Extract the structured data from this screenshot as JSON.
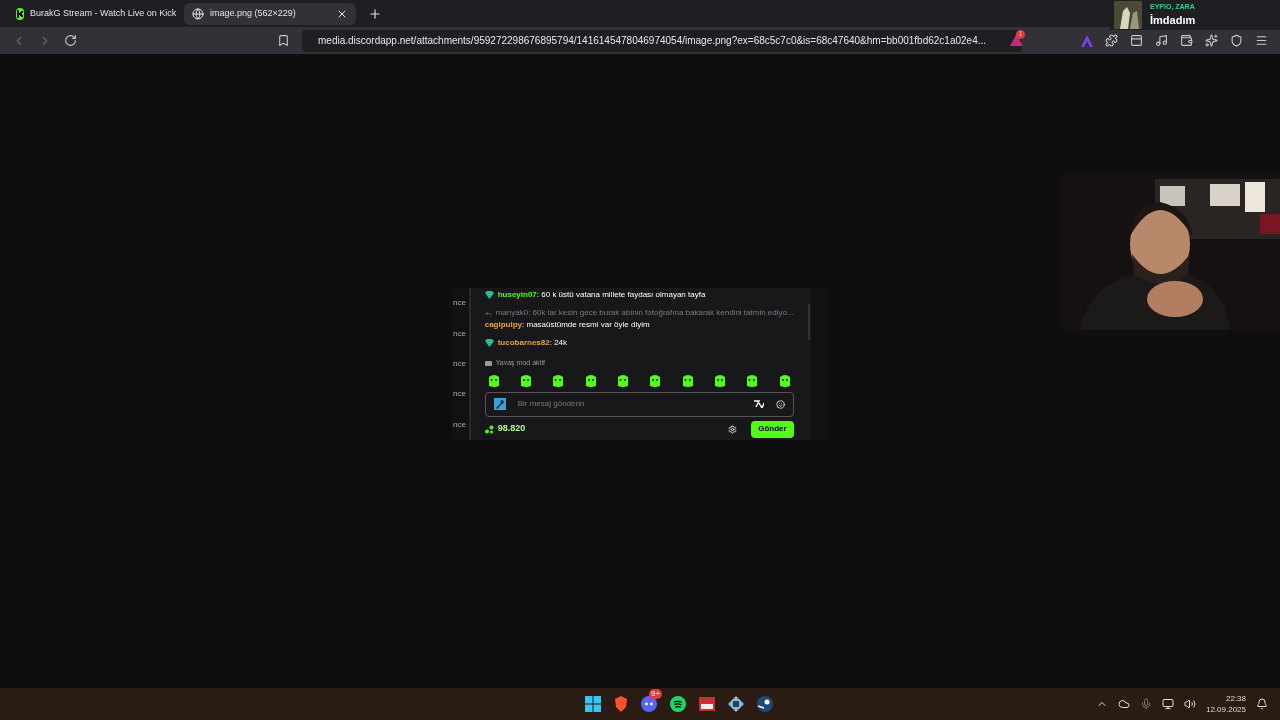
{
  "browser": {
    "tabs": [
      {
        "title": "BurakG Stream - Watch Live on Kick",
        "selected": false
      },
      {
        "title": "image.png (562×229)",
        "selected": true
      }
    ],
    "url": "media.discordapp.net/attachments/959272298676895794/1416145478046974054/image.png?ex=68c5c7c0&is=68c47640&hm=bb001fbd62c1a02e4...",
    "extension_badge": "1"
  },
  "now_playing": {
    "artist": "EYPIO, ZARA",
    "title": "İmdadım"
  },
  "chat_image": {
    "side_labels": [
      "nce",
      "nce",
      "nce",
      "nce",
      "nce"
    ],
    "messages": [
      {
        "kind": "message",
        "badge": true,
        "user": "huseyin07",
        "color": "#53fc18",
        "text": ": 60 k üstü vatana millete faydası olmayan tayfa"
      },
      {
        "kind": "reply",
        "text": "manyak0: 60k lar kesin gece burak abinin fotoğrafına bakarak kendini tatmin ediyo..."
      },
      {
        "kind": "message",
        "badge": false,
        "user": "cagipulpy",
        "color": "#e8a33c",
        "text": ": masaüstümde resmi var öyle diyim"
      },
      {
        "kind": "message",
        "badge": true,
        "user": "tucobarnes82",
        "color": "#e8a33c",
        "text": ": 24k"
      }
    ],
    "slow_mode": "Yavaş mod aktif",
    "input": {
      "placeholder": "Bir mesaj gönderin"
    },
    "points": "98.820",
    "send_button": "Gönder"
  },
  "taskbar": {
    "discord_badge": "9+",
    "time": "22:38",
    "date": "12.09.2025"
  }
}
